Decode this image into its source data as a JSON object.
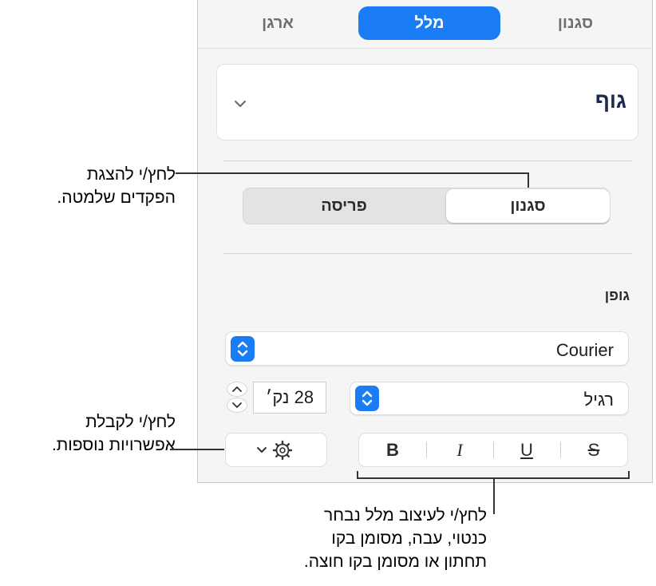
{
  "tabs": [
    {
      "label": "סגנון",
      "selected": false
    },
    {
      "label": "מלל",
      "selected": true
    },
    {
      "label": "ארגן",
      "selected": false
    }
  ],
  "paragraph_style": {
    "value": "גוף"
  },
  "segmented": [
    {
      "label": "סגנון",
      "active": true
    },
    {
      "label": "פריסה",
      "active": false
    }
  ],
  "font_section": {
    "label": "גופן",
    "family": "Courier",
    "typeface": "רגיל",
    "size": "28 נק׳"
  },
  "format_buttons": [
    {
      "name": "bold",
      "label": "B"
    },
    {
      "name": "italic",
      "label": "I"
    },
    {
      "name": "underline",
      "label": "U"
    },
    {
      "name": "strikethrough",
      "label": "S"
    }
  ],
  "callouts": {
    "style_line1": "לחץ/י להצגת",
    "style_line2": "הפקדים שלמטה.",
    "options_line1": "לחץ/י לקבלת",
    "options_line2": "אפשרויות נוספות.",
    "format_line1": "לחץ/י לעיצוב מלל נבחר",
    "format_line2": "כנטוי, עבה, מסומן בקו",
    "format_line3": "תחתון או מסומן בקו חוצה."
  },
  "colors": {
    "accent": "#1a7df5",
    "panel_bg": "#f5f5f5"
  }
}
